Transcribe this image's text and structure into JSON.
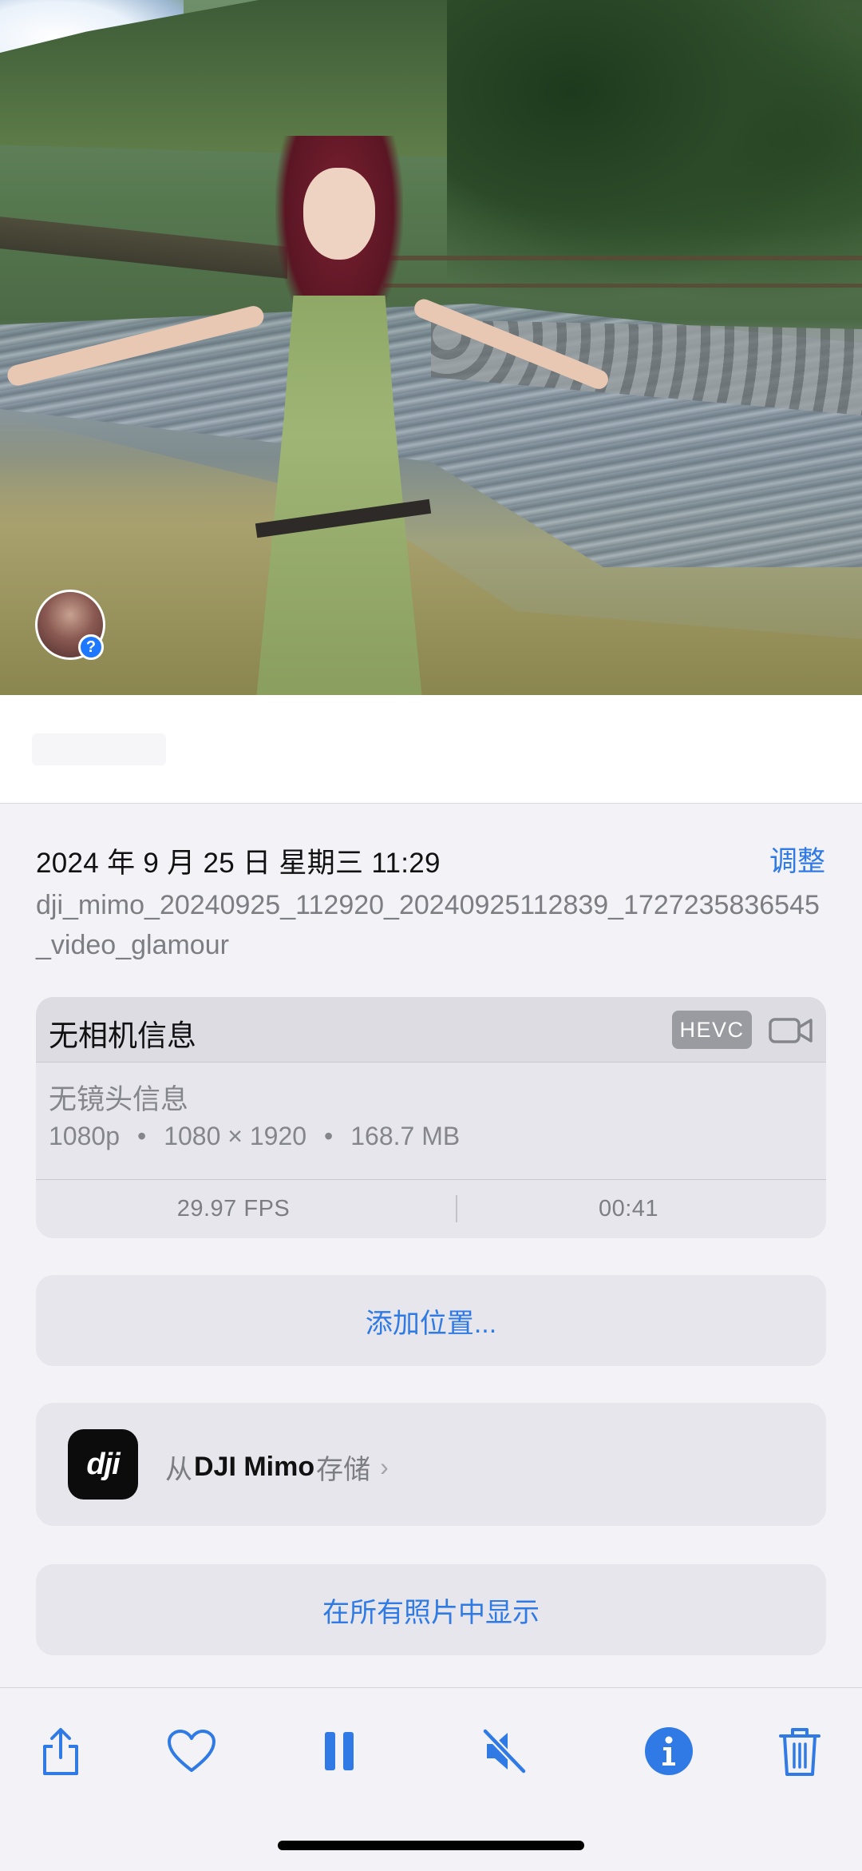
{
  "photo": {
    "description_icon": "photo-preview"
  },
  "caption": {
    "placeholder": ""
  },
  "info": {
    "datetime": "2024 年 9 月 25 日 星期三 11:29",
    "adjust_label": "调整",
    "filename": "dji_mimo_20240925_112920_20240925112839_1727235836545_video_glamour"
  },
  "camera": {
    "title": "无相机信息",
    "codec": "HEVC",
    "lens": "无镜头信息",
    "resolution_label": "1080p",
    "dimensions": "1080 × 1920",
    "size": "168.7 MB",
    "separator": "•",
    "fps": "29.97 FPS",
    "duration": "00:41"
  },
  "actions": {
    "add_location": "添加位置...",
    "saved_from_prefix": "从",
    "saved_from_app": "DJI Mimo",
    "saved_from_suffix": "存储",
    "show_in_all_photos": "在所有照片中显示"
  },
  "colors": {
    "accent": "#2f7ae5",
    "badge": "#1e78ff"
  },
  "toolbar": [
    "share-icon",
    "heart-icon",
    "pause-icon",
    "mute-icon",
    "info-icon",
    "trash-icon"
  ]
}
